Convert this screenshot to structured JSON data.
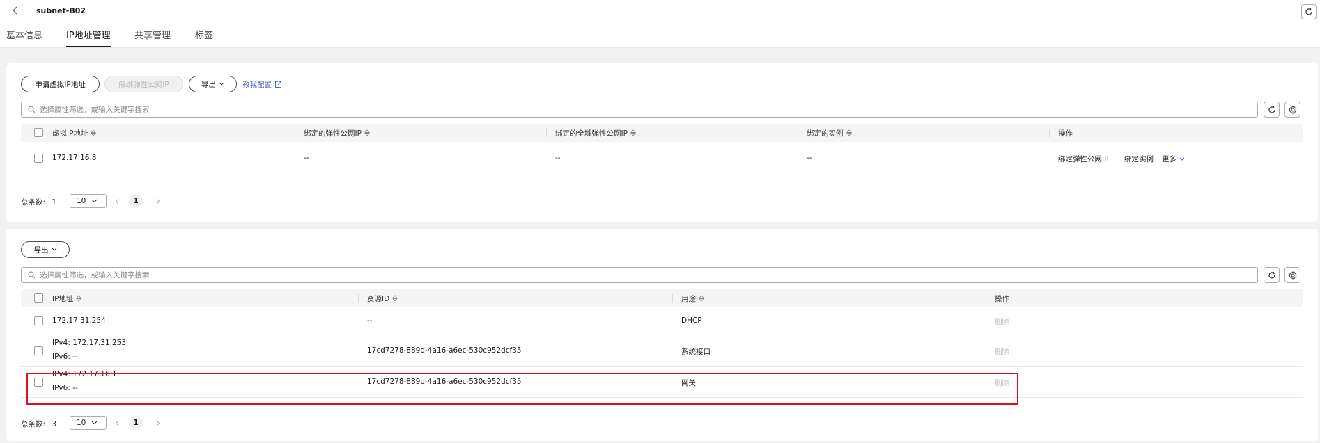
{
  "header": {
    "title": "subnet-B02",
    "tabs": [
      "基本信息",
      "IP地址管理",
      "共享管理",
      "标签"
    ],
    "active_tab": "IP地址管理"
  },
  "virtual_ip_panel": {
    "apply_button": "申请虚拟IP地址",
    "unbind_eip_button": "解绑弹性公网IP",
    "export_button": "导出",
    "tutorial_link": "教我配置",
    "search_placeholder": "选择属性筛选，或输入关键字搜索",
    "columns": [
      "虚拟IP地址",
      "绑定的弹性公网IP",
      "绑定的全域弹性公网IP",
      "绑定的实例",
      "操作"
    ],
    "rows": [
      {
        "ip": "172.17.16.8",
        "eip": "--",
        "global_eip": "--",
        "instance": "--",
        "actions": [
          "绑定弹性公网IP",
          "绑定实例",
          "更多"
        ]
      }
    ],
    "pagination": {
      "total_label": "总条数:",
      "total": "1",
      "page_size": "10",
      "current_page": "1"
    }
  },
  "ip_list_panel": {
    "export_button": "导出",
    "search_placeholder": "选择属性筛选，或输入关键字搜索",
    "columns": [
      "IP地址",
      "资源ID",
      "用途",
      "操作"
    ],
    "rows": [
      {
        "ip_line1": "172.17.31.254",
        "ip_line2": "",
        "resource_id": "--",
        "usage": "DHCP",
        "action": "删除"
      },
      {
        "ip_line1": "IPv4: 172.17.31.253",
        "ip_line2": "IPv6: --",
        "resource_id": "17cd7278-889d-4a16-a6ec-530c952dcf35",
        "usage": "系统接口",
        "action": "删除"
      },
      {
        "ip_line1": "IPv4: 172.17.16.1",
        "ip_line2": "IPv6: --",
        "resource_id": "17cd7278-889d-4a16-a6ec-530c952dcf35",
        "usage": "网关",
        "action": "删除"
      }
    ],
    "pagination": {
      "total_label": "总条数:",
      "total": "3",
      "page_size": "10",
      "current_page": "1"
    }
  },
  "colors": {
    "link": "#526ecc",
    "highlight": "#e0101a",
    "active_tab": "#191919"
  }
}
